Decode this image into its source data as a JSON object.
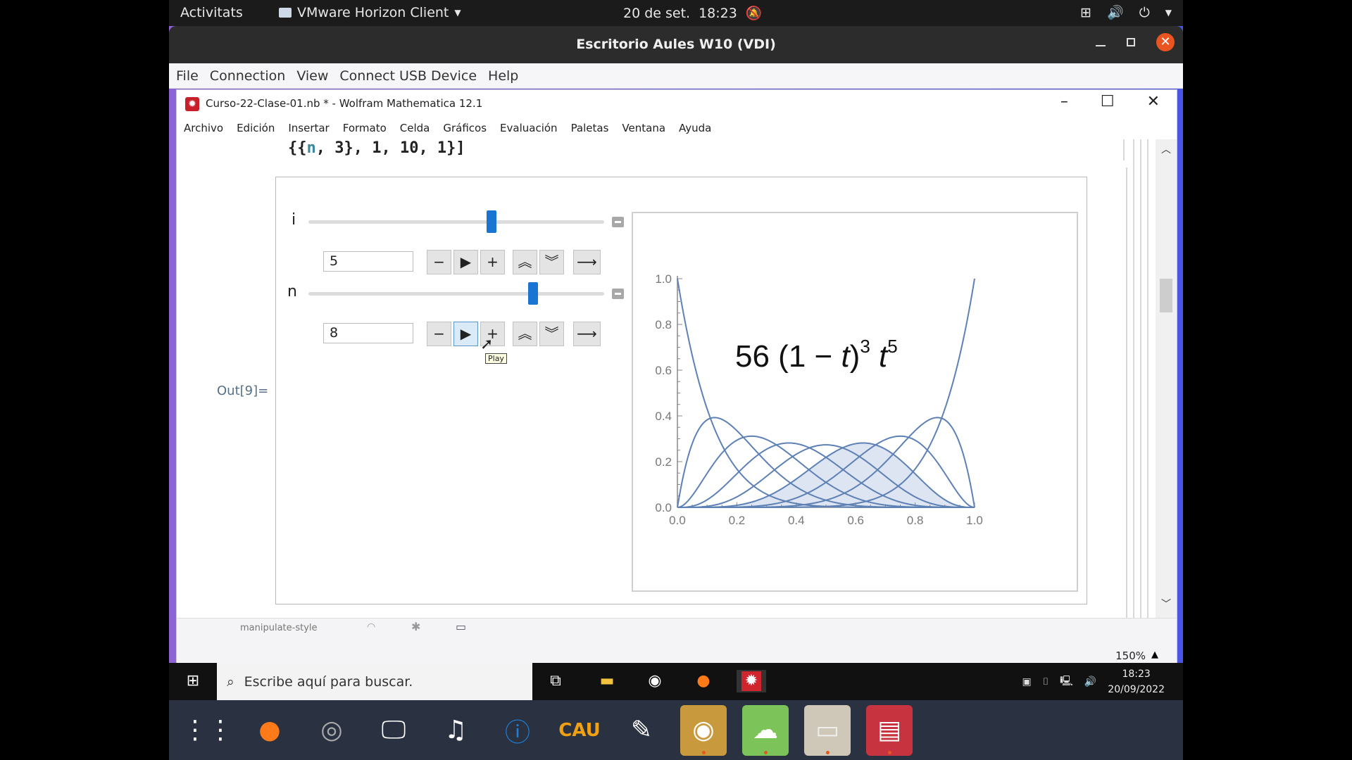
{
  "gnome_topbar": {
    "activities": "Activitats",
    "app_menu": "VMware Horizon Client",
    "date": "20 de set.",
    "time": "18:23",
    "icons": [
      "notifications-off-icon",
      "network-icon",
      "volume-icon",
      "power-icon",
      "chevron-down-icon"
    ]
  },
  "vdi_window": {
    "title": "Escritorio Aules W10 (VDI)",
    "menu": [
      "File",
      "Connection",
      "View",
      "Connect USB Device",
      "Help"
    ]
  },
  "mathematica": {
    "title": "Curso-22-Clase-01.nb * - Wolfram Mathematica 12.1",
    "menu": [
      "Archivo",
      "Edición",
      "Insertar",
      "Formato",
      "Celda",
      "Gráficos",
      "Evaluación",
      "Paletas",
      "Ventana",
      "Ayuda"
    ],
    "code_line_prefix": "{{",
    "code_line_var": "n",
    "code_line_suffix": ", 3}, 1, 10, 1}]",
    "out_label": "Out[9]=",
    "zoom_level": "150%",
    "tooltip": "Play",
    "controls": [
      {
        "label": "i",
        "value": "5",
        "slider_fraction": 0.62
      },
      {
        "label": "n",
        "value": "8",
        "slider_fraction": 0.76
      }
    ],
    "status_icons": [
      "manipulate-style",
      "undo-icon",
      "gear-icon",
      "window-icon"
    ]
  },
  "chart_data": {
    "type": "line",
    "title": "",
    "annotation": "56 (1 − t)³ t⁵",
    "annotation_parts": {
      "coef": "56 (1 − ",
      "t1": "t",
      "close": ")",
      "exp1": "3",
      "t2": "t",
      "exp2": "5"
    },
    "description": "Bernstein basis polynomials B(k,8)(t) = C(8,k) t^k (1-t)^(8-k), k = 0..8; B(5,8) highlighted/shaded",
    "degree": 8,
    "highlighted_index": 5,
    "x_range": [
      0,
      1
    ],
    "ylim": [
      0,
      1
    ],
    "xticks": [
      "0.0",
      "0.2",
      "0.4",
      "0.6",
      "0.8",
      "1.0"
    ],
    "yticks": [
      "0.0",
      "0.2",
      "0.4",
      "0.6",
      "0.8",
      "1.0"
    ],
    "series_peaks": [
      {
        "k": 0,
        "peak_t": 0.0,
        "peak_value": 1.0
      },
      {
        "k": 1,
        "peak_t": 0.125,
        "peak_value": 0.393
      },
      {
        "k": 2,
        "peak_t": 0.25,
        "peak_value": 0.311
      },
      {
        "k": 3,
        "peak_t": 0.375,
        "peak_value": 0.279
      },
      {
        "k": 4,
        "peak_t": 0.5,
        "peak_value": 0.273
      },
      {
        "k": 5,
        "peak_t": 0.625,
        "peak_value": 0.279
      },
      {
        "k": 6,
        "peak_t": 0.75,
        "peak_value": 0.311
      },
      {
        "k": 7,
        "peak_t": 0.875,
        "peak_value": 0.393
      },
      {
        "k": 8,
        "peak_t": 1.0,
        "peak_value": 1.0
      }
    ],
    "line_color": "#5e81b5",
    "fill_color": "#dde4f2"
  },
  "windows_taskbar": {
    "search_placeholder": "Escribe aquí para buscar.",
    "apps": [
      "task-view-icon",
      "file-explorer-icon",
      "chrome-icon",
      "firefox-icon",
      "mathematica-icon"
    ],
    "tray_icons": [
      "vmware-icon",
      "usb-icon",
      "network-icon",
      "volume-icon"
    ],
    "time": "18:23",
    "date": "20/09/2022"
  },
  "dock": {
    "apps": [
      "app-grid-icon",
      "firefox-icon",
      "disk-icon",
      "remote-desktop-icon",
      "music-icon",
      "info-icon",
      "cau-icon",
      "notes-icon",
      "chrome-icon",
      "cloud-icon",
      "files-icon",
      "document-viewer-icon"
    ]
  }
}
